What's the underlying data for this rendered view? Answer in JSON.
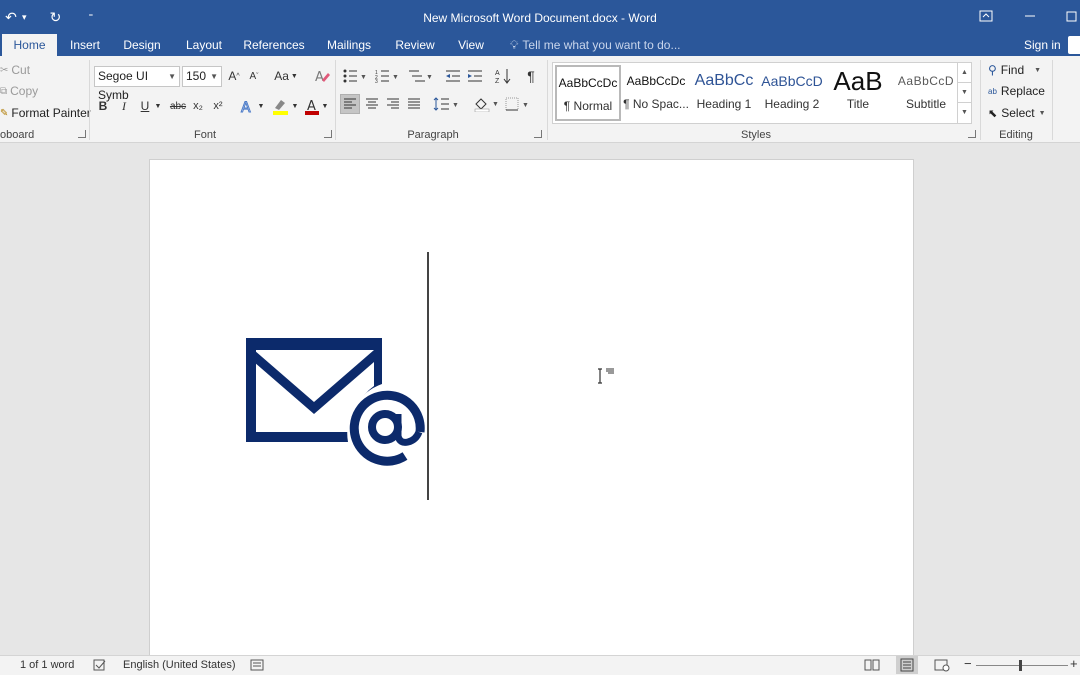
{
  "app": {
    "title": "New Microsoft Word Document.docx - Word"
  },
  "tabs": [
    {
      "label": "Home",
      "active": true
    },
    {
      "label": "Insert"
    },
    {
      "label": "Design"
    },
    {
      "label": "Layout"
    },
    {
      "label": "References"
    },
    {
      "label": "Mailings"
    },
    {
      "label": "Review"
    },
    {
      "label": "View"
    }
  ],
  "tell_me": "Tell me what you want to do...",
  "sign_in": "Sign in",
  "clipboard": {
    "cut": "Cut",
    "copy": "Copy",
    "format_painter": "Format Painter",
    "group_label": "oboard"
  },
  "font": {
    "name": "Segoe UI Symb",
    "size": "150",
    "group_label": "Font",
    "change_case": "Aa",
    "bold": "B",
    "italic": "I",
    "underline": "U",
    "strike": "abc",
    "subscript": "x₂",
    "superscript": "x²"
  },
  "paragraph": {
    "group_label": "Paragraph"
  },
  "styles": {
    "group_label": "Styles",
    "items": [
      {
        "preview": "AaBbCcDc",
        "name": "¶ Normal"
      },
      {
        "preview": "AaBbCcDc",
        "name": "¶ No Spac..."
      },
      {
        "preview": "AaBbCc",
        "name": "Heading 1"
      },
      {
        "preview": "AaBbCcD",
        "name": "Heading 2"
      },
      {
        "preview": "AaB",
        "name": "Title"
      },
      {
        "preview": "AaBbCcD",
        "name": "Subtitle"
      }
    ]
  },
  "editing": {
    "group_label": "Editing",
    "find": "Find",
    "replace": "Replace",
    "select": "Select"
  },
  "status": {
    "word_count": "1 of 1 word",
    "language": "English (United States)"
  },
  "colors": {
    "brand": "#2b579a",
    "logo": "#0c2a6b",
    "highlight": "#ffff00",
    "font_color": "#c00000"
  }
}
